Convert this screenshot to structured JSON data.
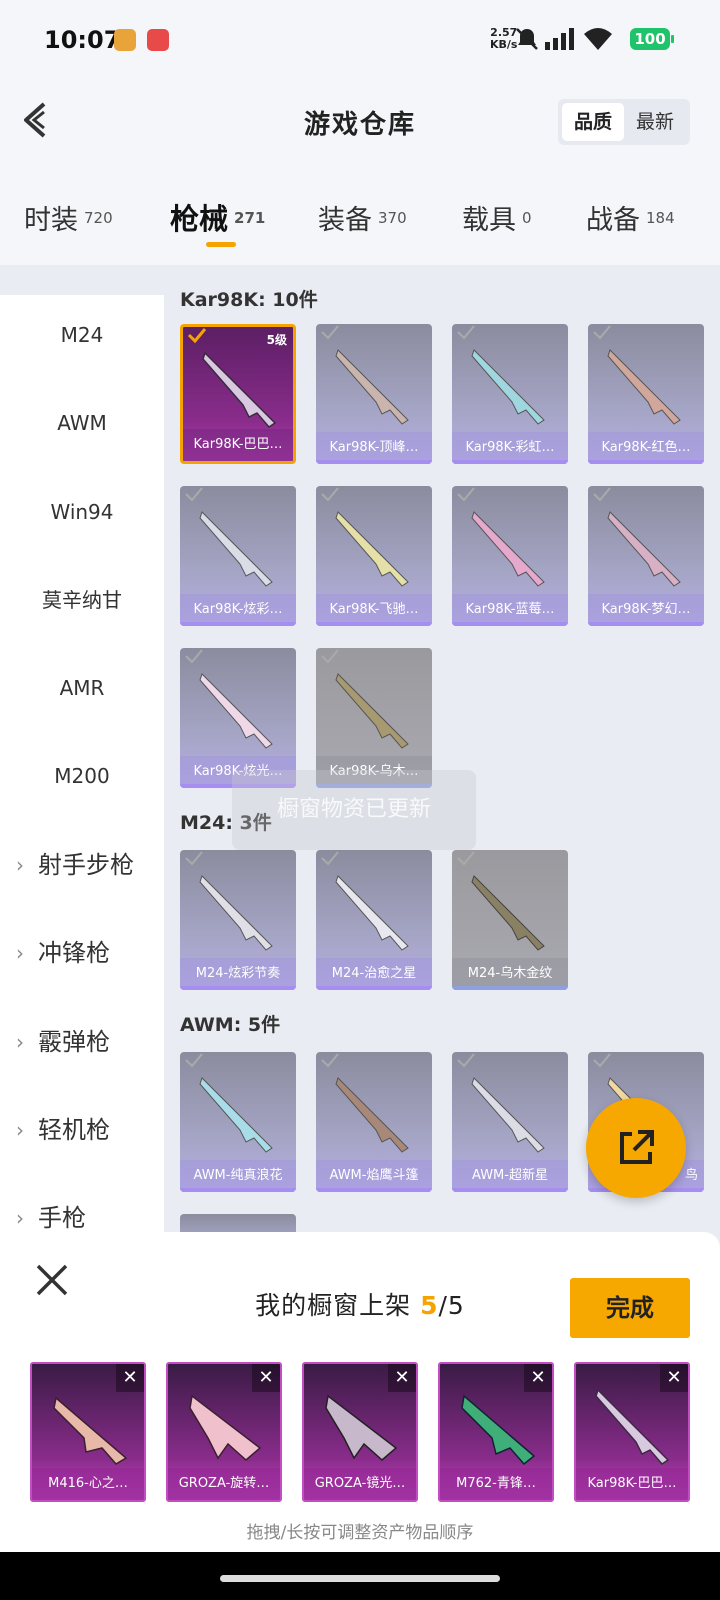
{
  "status": {
    "time": "10:07",
    "net_speed_value": "2.57",
    "net_speed_unit": "KB/s",
    "battery": "100"
  },
  "header": {
    "title": "游戏仓库",
    "sort_quality": "品质",
    "sort_newest": "最新"
  },
  "tabs": [
    {
      "label": "时装",
      "count": "720"
    },
    {
      "label": "枪械",
      "count": "271"
    },
    {
      "label": "装备",
      "count": "370"
    },
    {
      "label": "载具",
      "count": "0"
    },
    {
      "label": "战备",
      "count": "184"
    }
  ],
  "sidebar": {
    "items": [
      "M24",
      "AWM",
      "Win94",
      "莫辛纳甘",
      "AMR",
      "M200"
    ],
    "categories": [
      "射手步枪",
      "冲锋枪",
      "霰弹枪",
      "轻机枪",
      "手枪"
    ]
  },
  "sections": {
    "kar98k": {
      "heading": "Kar98K: 10件",
      "items": [
        "Kar98K-巴巴…",
        "Kar98K-顶峰…",
        "Kar98K-彩虹…",
        "Kar98K-红色…",
        "Kar98K-炫彩…",
        "Kar98K-飞驰…",
        "Kar98K-蓝莓…",
        "Kar98K-梦幻…",
        "Kar98K-炫光…",
        "Kar98K-乌木…"
      ],
      "level_badge": "5级"
    },
    "m24": {
      "heading": "M24: 3件",
      "items": [
        "M24-炫彩节奏",
        "M24-治愈之星",
        "M24-乌木金纹"
      ]
    },
    "awm": {
      "heading": "AWM: 5件",
      "items": [
        "AWM-纯真浪花",
        "AWM-焰鹰斗篷",
        "AWM-超新星",
        "鸟"
      ]
    }
  },
  "toast": "橱窗物资已更新",
  "panel": {
    "title_prefix": "我的橱窗上架 ",
    "count_current": "5",
    "count_total": "/5",
    "done": "完成",
    "items": [
      "M416-心之…",
      "GROZA-旋转…",
      "GROZA-镜光…",
      "M762-青锋…",
      "Kar98K-巴巴…"
    ],
    "hint": "拖拽/长按可调整资产物品顺序"
  },
  "colors": {
    "accent": "#f7a800",
    "selected_border": "#f5a300",
    "legendary_purple": "#8a2c8c"
  }
}
